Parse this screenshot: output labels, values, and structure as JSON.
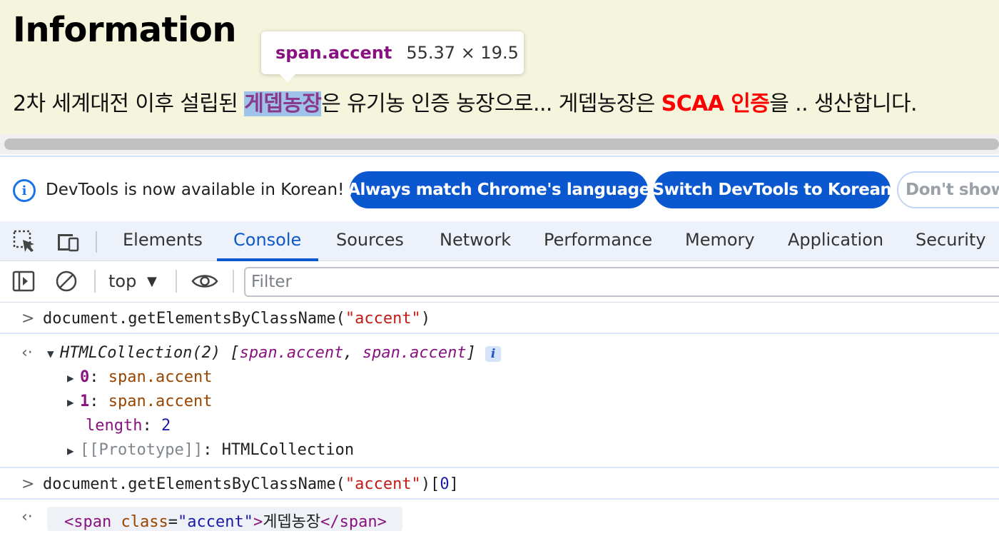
{
  "page": {
    "title": "Information",
    "para_before": "2차 세계대전 이후 설립된 ",
    "para_highlight": "게뎁농장",
    "para_middle": "은 유기농 인증 농장으로... 게뎁농장은 ",
    "para_red": "SCAA 인증",
    "para_after": "을 .. 생산합니다."
  },
  "tooltip": {
    "selector": "span.accent",
    "dimensions": "55.37 × 19.5"
  },
  "infobar": {
    "message": "DevTools is now available in Korean!",
    "btn_match": "Always match Chrome's language",
    "btn_switch": "Switch DevTools to Korean",
    "btn_dont": "Don't show"
  },
  "tabs": [
    "Elements",
    "Console",
    "Sources",
    "Network",
    "Performance",
    "Memory",
    "Application",
    "Security"
  ],
  "active_tab": "Console",
  "toolbar": {
    "context": "top",
    "filter_placeholder": "Filter"
  },
  "console": {
    "cmd1_fn": "document.getElementsByClassName(",
    "cmd1_arg": "\"accent\"",
    "cmd1_close": ")",
    "result_head_type": "HTMLCollection(2) ",
    "result_head_open": "[",
    "result_head_item1": "span.accent",
    "result_head_comma": ", ",
    "result_head_item2": "span.accent",
    "result_head_close": "]",
    "info_badge": "i",
    "item0_key": "0",
    "item0_val": "span.accent",
    "item1_key": "1",
    "item1_val": "span.accent",
    "length_key": "length",
    "length_val": "2",
    "proto_key": "[[Prototype]]",
    "proto_val": "HTMLCollection",
    "cmd2_fn": "document.getElementsByClassName(",
    "cmd2_arg": "\"accent\"",
    "cmd2_close": ")[",
    "cmd2_index": "0",
    "cmd2_end": "]",
    "result2_open": "<span ",
    "result2_attr": "class",
    "result2_eq": "=",
    "result2_attrval": "\"accent\"",
    "result2_gt": ">",
    "result2_text": "게뎁농장",
    "result2_close": "</span>"
  },
  "colors": {
    "page_bg": "#f5f4dc",
    "accent_blue": "#0b57d0",
    "red": "#ff0000",
    "selector_purple": "#881280"
  }
}
